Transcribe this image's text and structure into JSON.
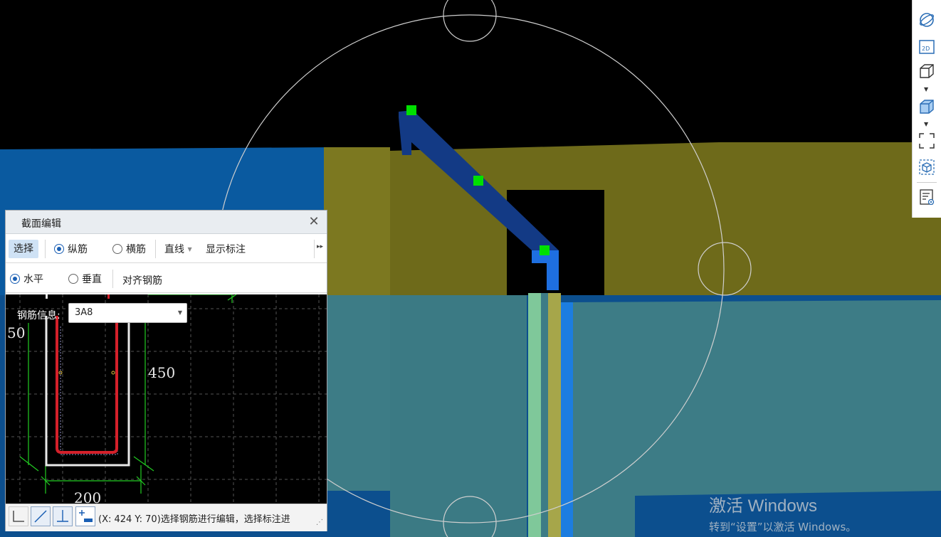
{
  "panel": {
    "title": "截面编辑",
    "close_glyph": "✕",
    "row1": {
      "select_label": "选择",
      "longitudinal_label": "纵筋",
      "transverse_label": "横筋",
      "line_label": "直线",
      "show_annotation_label": "显示标注",
      "more_glyph": "▸▸"
    },
    "row2": {
      "horizontal_label": "水平",
      "vertical_label": "垂直",
      "align_label": "对齐钢筋"
    },
    "rebar_info_label": "钢筋信息:",
    "rebar_info_value": "3A8",
    "dims": {
      "height": "450",
      "width": "200",
      "left_partial": "50"
    },
    "status_text": "(X: 424 Y: 70)选择钢筋进行编辑，选择标注进"
  },
  "view_toolbar": {
    "icons": [
      "orbit-icon",
      "view-2d-icon",
      "cube-view-icon",
      "cube-shaded-icon",
      "fullscreen-icon",
      "local-3d-icon",
      "display-settings-icon"
    ],
    "label_2d": "2D"
  },
  "watermark": {
    "title": "激活 Windows",
    "subtitle": "转到“设置”以激活 Windows。"
  },
  "colors": {
    "beam_olive": "#6e6a1a",
    "wall_teal": "#3d7c86",
    "slab_blue": "#0a5aa0",
    "rebar_navy": "#133a85",
    "grip_green": "#00e000",
    "rebar_red": "#d4202a"
  }
}
